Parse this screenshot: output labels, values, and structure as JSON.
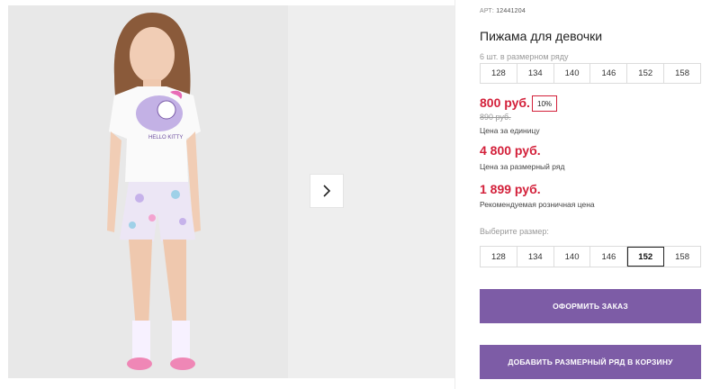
{
  "product": {
    "article_label": "АРТ:",
    "article_number": "12441204",
    "title": "Пижама для девочки",
    "series_note": "6 шт. в размерном ряду",
    "series_sizes": [
      "128",
      "134",
      "140",
      "146",
      "152",
      "158"
    ],
    "price": "800 руб.",
    "discount": "10%",
    "old_price": "890 руб.",
    "price_unit_label": "Цена за единицу",
    "series_price": "4 800 руб.",
    "series_price_label": "Цена за размерный ряд",
    "rrp_price": "1 899 руб.",
    "rrp_label": "Рекомендуемая розничная цена"
  },
  "size_picker": {
    "label": "Выберите размер:",
    "sizes": [
      "128",
      "134",
      "140",
      "146",
      "152",
      "158"
    ],
    "selected": "152"
  },
  "buttons": {
    "order": "ОФОРМИТЬ ЗАКАЗ",
    "add_series": "ДОБАВИТЬ РАЗМЕРНЫЙ РЯД В КОРЗИНУ"
  },
  "colors": {
    "accent": "#7d5ca6",
    "price": "#d3203a"
  },
  "icons": {
    "next": "chevron-right-icon"
  }
}
